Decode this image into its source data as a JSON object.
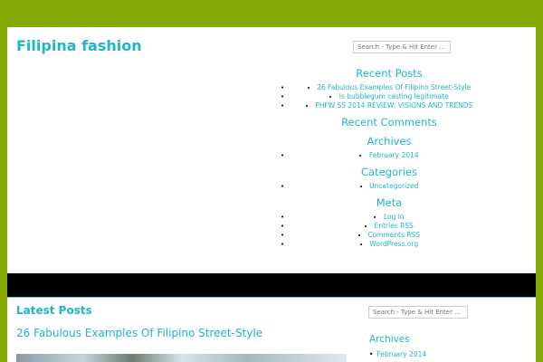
{
  "site": {
    "title": "Filipina fashion"
  },
  "search": {
    "placeholder": "Search - Type & Hit Enter ..."
  },
  "sidebar": {
    "recent_posts": {
      "title": "Recent Posts",
      "items": [
        "26 Fabulous Examples Of Filipino Street-Style",
        "Is bubblegum casting legitimate",
        "PHFW SS 2014 REVIEW: VISIONS AND TRENDS"
      ]
    },
    "recent_comments": {
      "title": "Recent Comments"
    },
    "archives": {
      "title": "Archives",
      "items": [
        "February 2014"
      ]
    },
    "categories": {
      "title": "Categories",
      "items": [
        "Uncategorized"
      ]
    },
    "meta": {
      "title": "Meta",
      "items": [
        "Log in",
        "Entries RSS",
        "Comments RSS",
        "WordPress.org"
      ]
    }
  },
  "main": {
    "section_title": "Latest Posts",
    "post_title": "26 Fabulous Examples Of Filipino Street-Style"
  },
  "bottom_sidebar": {
    "archives_title": "Archives",
    "archive_item": "February 2014"
  },
  "colors": {
    "background": "#86a802",
    "accent": "#1fb6c8",
    "bar": "#000000"
  }
}
